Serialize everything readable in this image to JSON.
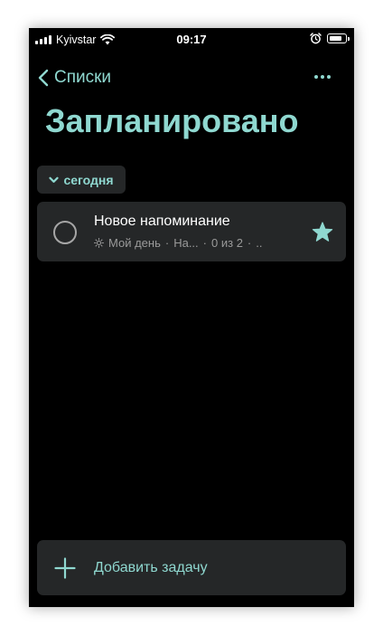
{
  "status_bar": {
    "carrier": "Kyivstar",
    "time": "09:17",
    "icons": [
      "cellular-signal-icon",
      "wifi-icon",
      "alarm-clock-icon",
      "battery-icon"
    ]
  },
  "nav": {
    "back_label": "Списки",
    "more_icon": "ellipsis-icon"
  },
  "page": {
    "title": "Запланировано"
  },
  "groups": [
    {
      "label": "сегодня",
      "expanded": true,
      "tasks": [
        {
          "title": "Новое напоминание",
          "my_day": "Мой день",
          "separator": "·",
          "list": "На...",
          "steps": "0 из 2",
          "overflow": "..",
          "completed": false,
          "important": true
        }
      ]
    }
  ],
  "add_task": {
    "label": "Добавить задачу"
  },
  "colors": {
    "accent": "#8fd8d0",
    "background": "#000000",
    "card": "#252728",
    "secondary_text": "#9a9a9a"
  }
}
